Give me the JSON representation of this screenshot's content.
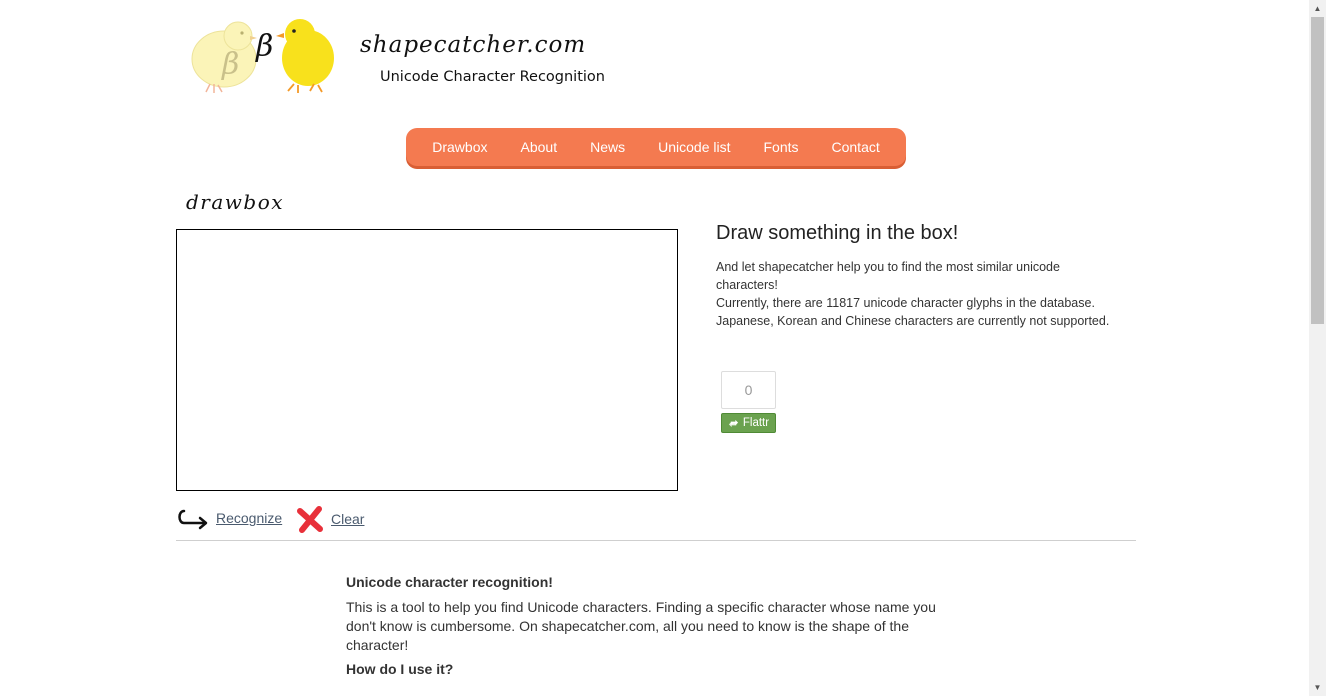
{
  "header": {
    "site_name": "shapecatcher.com",
    "tagline": "Unicode Character Recognition",
    "logo_glyph": "β"
  },
  "nav": {
    "items": [
      {
        "label": "Drawbox"
      },
      {
        "label": "About"
      },
      {
        "label": "News"
      },
      {
        "label": "Unicode list"
      },
      {
        "label": "Fonts"
      },
      {
        "label": "Contact"
      }
    ]
  },
  "drawbox": {
    "title": "drawbox",
    "recognize_label": "Recognize",
    "clear_label": "Clear"
  },
  "info": {
    "title": "Draw something in the box!",
    "line1": "And let shapecatcher help you to find the most similar unicode characters!",
    "line2": "Currently, there are 11817 unicode character glyphs in the database.",
    "line3": "Japanese, Korean and Chinese characters are currently not supported."
  },
  "flattr": {
    "count": "0",
    "label": "Flattr"
  },
  "content": {
    "heading": "Unicode character recognition!",
    "paragraph": "This is a tool to help you find Unicode characters. Finding a specific character whose name you don't know is cumbersome. On shapecatcher.com, all you need to know is the shape of the character!",
    "subheading": "How do I use it?"
  },
  "colors": {
    "nav_bg": "#f47a50",
    "flattr_green": "#6ba24f",
    "clear_red": "#e8303a"
  }
}
